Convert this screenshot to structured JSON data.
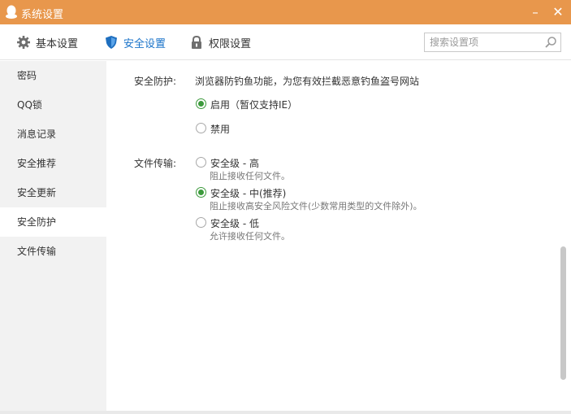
{
  "window": {
    "title": "系统设置",
    "minimize_label": "–",
    "close_label": "✕",
    "accent_color": "#e8974c"
  },
  "toolbar": {
    "tabs": [
      {
        "label": "基本设置",
        "icon": "gear-icon"
      },
      {
        "label": "安全设置",
        "icon": "shield-icon",
        "active": true
      },
      {
        "label": "权限设置",
        "icon": "lock-icon"
      }
    ],
    "search": {
      "placeholder": "搜索设置项",
      "value": ""
    }
  },
  "sidebar": {
    "items": [
      {
        "label": "密码"
      },
      {
        "label": "QQ锁"
      },
      {
        "label": "消息记录"
      },
      {
        "label": "安全推荐"
      },
      {
        "label": "安全更新"
      },
      {
        "label": "安全防护",
        "active": true
      },
      {
        "label": "文件传输"
      }
    ]
  },
  "main": {
    "protection": {
      "label": "安全防护:",
      "description": "浏览器防钓鱼功能，为您有效拦截恶意钓鱼盗号网站",
      "options": [
        {
          "label": "启用（暂仅支持IE）",
          "checked": true
        },
        {
          "label": "禁用",
          "checked": false
        }
      ]
    },
    "file_transfer": {
      "label": "文件传输:",
      "options": [
        {
          "label": "安全级 - 高",
          "sub": "阻止接收任何文件。",
          "checked": false
        },
        {
          "label": "安全级 - 中(推荐)",
          "sub": "阻止接收高安全风险文件(少数常用类型的文件除外)。",
          "checked": true
        },
        {
          "label": "安全级 - 低",
          "sub": "允许接收任何文件。",
          "checked": false
        }
      ]
    }
  }
}
